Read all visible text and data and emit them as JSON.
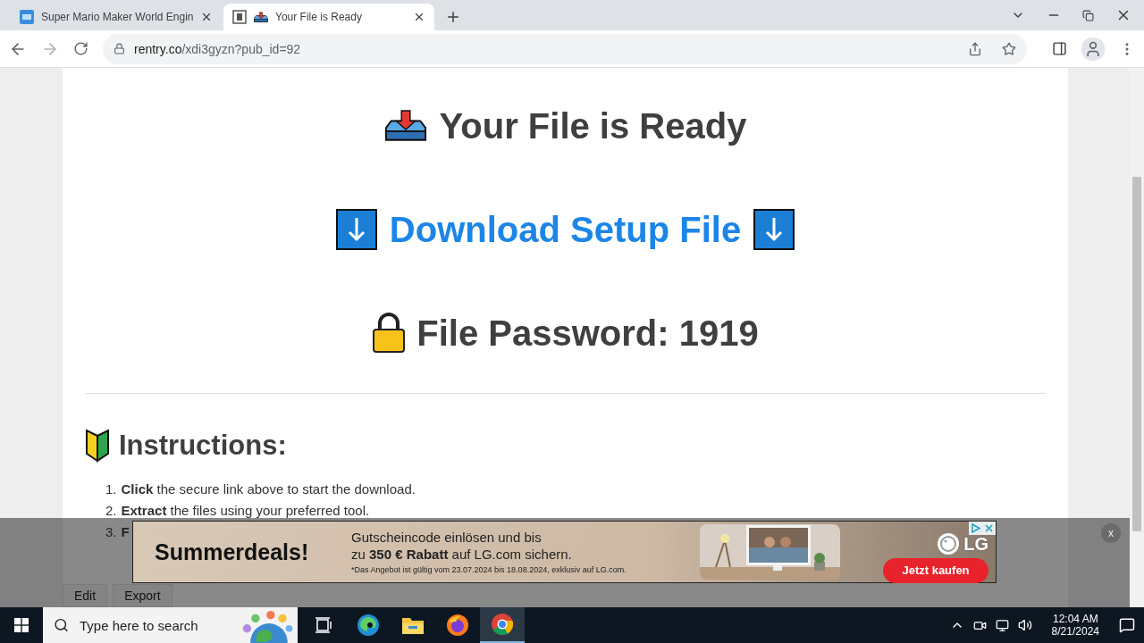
{
  "browser": {
    "tabs": [
      {
        "title": "Super Mario Maker World Engin",
        "selected": false
      },
      {
        "title": "Your File is Ready",
        "selected": true
      }
    ],
    "url_domain": "rentry.co",
    "url_path": "/xdi3gyzn?pub_id=92"
  },
  "page": {
    "title": "Your File is Ready",
    "download_link": "Download Setup File",
    "password": "File Password: 1919",
    "instructions_title": "Instructions:",
    "steps": [
      {
        "number": "1.",
        "lead": "Click",
        "rest": "the secure link above to start the download."
      },
      {
        "number": "2.",
        "lead": "Extract",
        "rest": "the files using your preferred tool."
      },
      {
        "number": "3.",
        "lead": "F"
      }
    ],
    "buttons": [
      "Edit",
      "Export"
    ]
  },
  "ad": {
    "headline": "Summerdeals!",
    "line1": "Gutscheincode einlösen und bis",
    "line2": "zu **350 € Rabatt** auf LG.com sichern.",
    "note": "*Das Angebot ist gültig vom 23.07.2024 bis 18.08.2024, exklusiv auf LG.com.",
    "brand": "LG",
    "cta": "Jetzt kaufen",
    "close": "x"
  },
  "taskbar": {
    "search_placeholder": "Type here to search",
    "time": "12:04 AM",
    "date": "8/21/2024"
  }
}
